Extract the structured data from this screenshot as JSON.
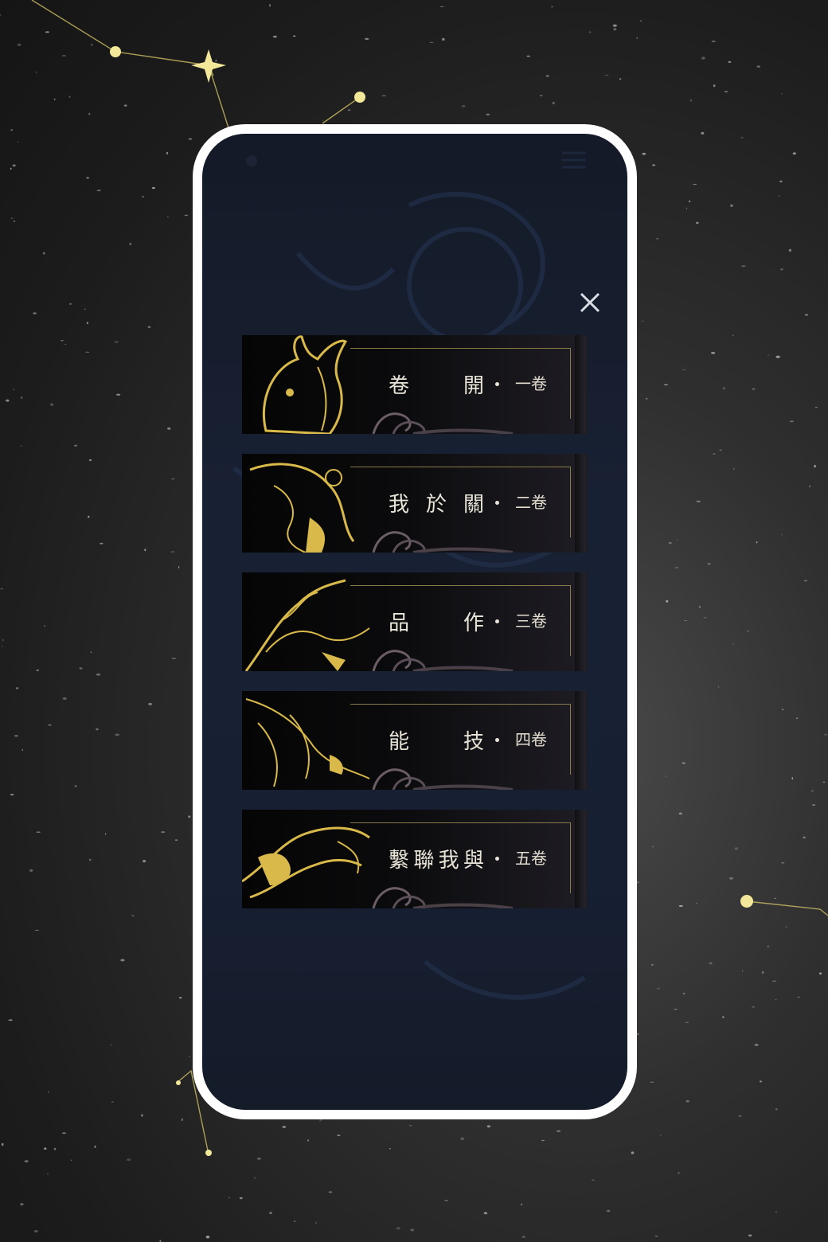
{
  "close_icon": "close-icon",
  "chapters": [
    {
      "title": "卷開",
      "title_chars": [
        "卷",
        "開"
      ],
      "number": "一卷",
      "art": "goat-icon"
    },
    {
      "title": "我於關",
      "title_chars": [
        "我",
        "於",
        "關"
      ],
      "number": "二卷",
      "art": "dragon-icon"
    },
    {
      "title": "品作",
      "title_chars": [
        "品",
        "作"
      ],
      "number": "三卷",
      "art": "phoenix-icon"
    },
    {
      "title": "能技",
      "title_chars": [
        "能",
        "技"
      ],
      "number": "四卷",
      "art": "beast-icon"
    },
    {
      "title": "繫聯我與",
      "title_chars": [
        "繫",
        "聯",
        "我",
        "與"
      ],
      "number": "五卷",
      "art": "qilin-icon"
    }
  ],
  "colors": {
    "gold": "#d8b94a",
    "text": "#e9e4d8",
    "screen_bg": "#172033"
  }
}
